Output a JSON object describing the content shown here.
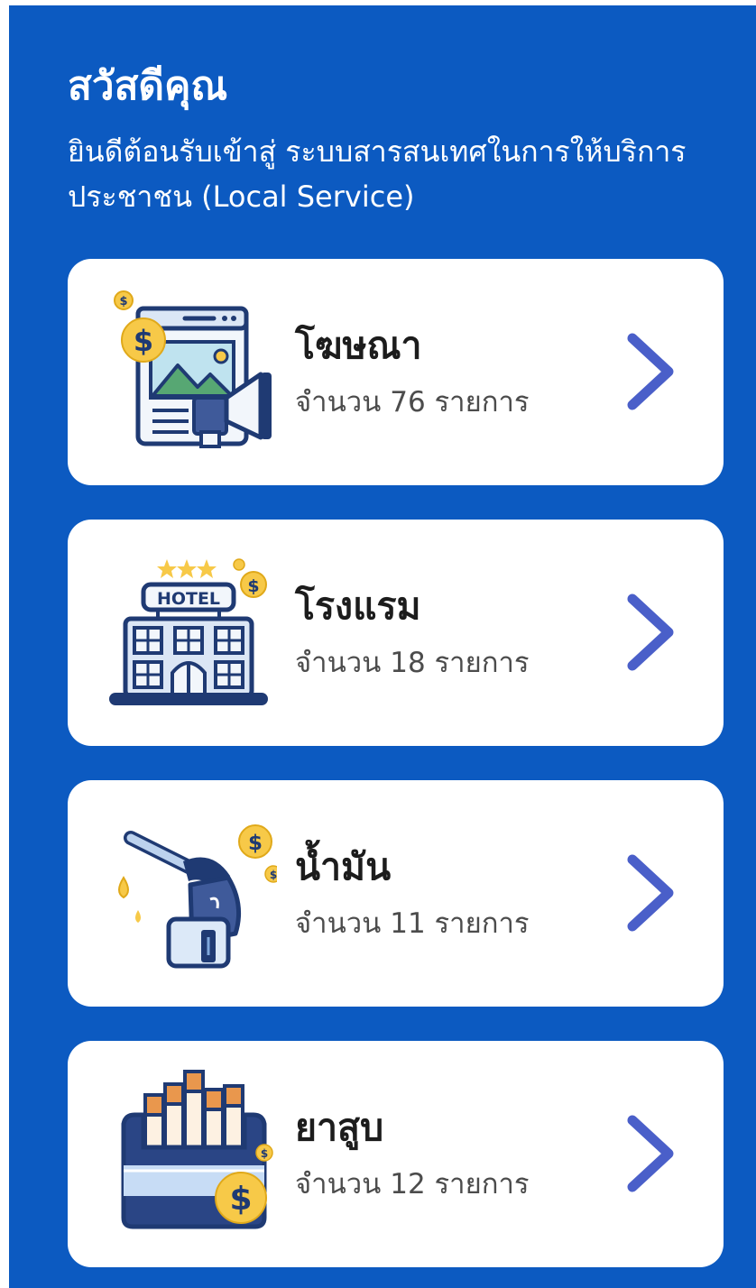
{
  "header": {
    "greeting": "สวัสดีคุณ",
    "welcome_text": "ยินดีต้อนรับเข้าสู่ ระบบสารสนเทศในการให้บริการประชาชน (Local Service)"
  },
  "categories": [
    {
      "title": "โฆษณา",
      "count_text": "จำนวน 76 รายการ",
      "icon": "advertising-icon"
    },
    {
      "title": "โรงแรม",
      "count_text": "จำนวน 18 รายการ",
      "icon": "hotel-icon",
      "icon_sign": "HOTEL"
    },
    {
      "title": "น้ำมัน",
      "count_text": "จำนวน 11 รายการ",
      "icon": "fuel-nozzle-icon"
    },
    {
      "title": "ยาสูบ",
      "count_text": "จำนวน 12 รายการ",
      "icon": "cigarette-pack-icon"
    }
  ],
  "colors": {
    "background": "#0c5ac1",
    "card": "#ffffff",
    "chevron": "#4a5fc9",
    "icon_navy": "#1f3a73",
    "coin": "#f7c948"
  }
}
